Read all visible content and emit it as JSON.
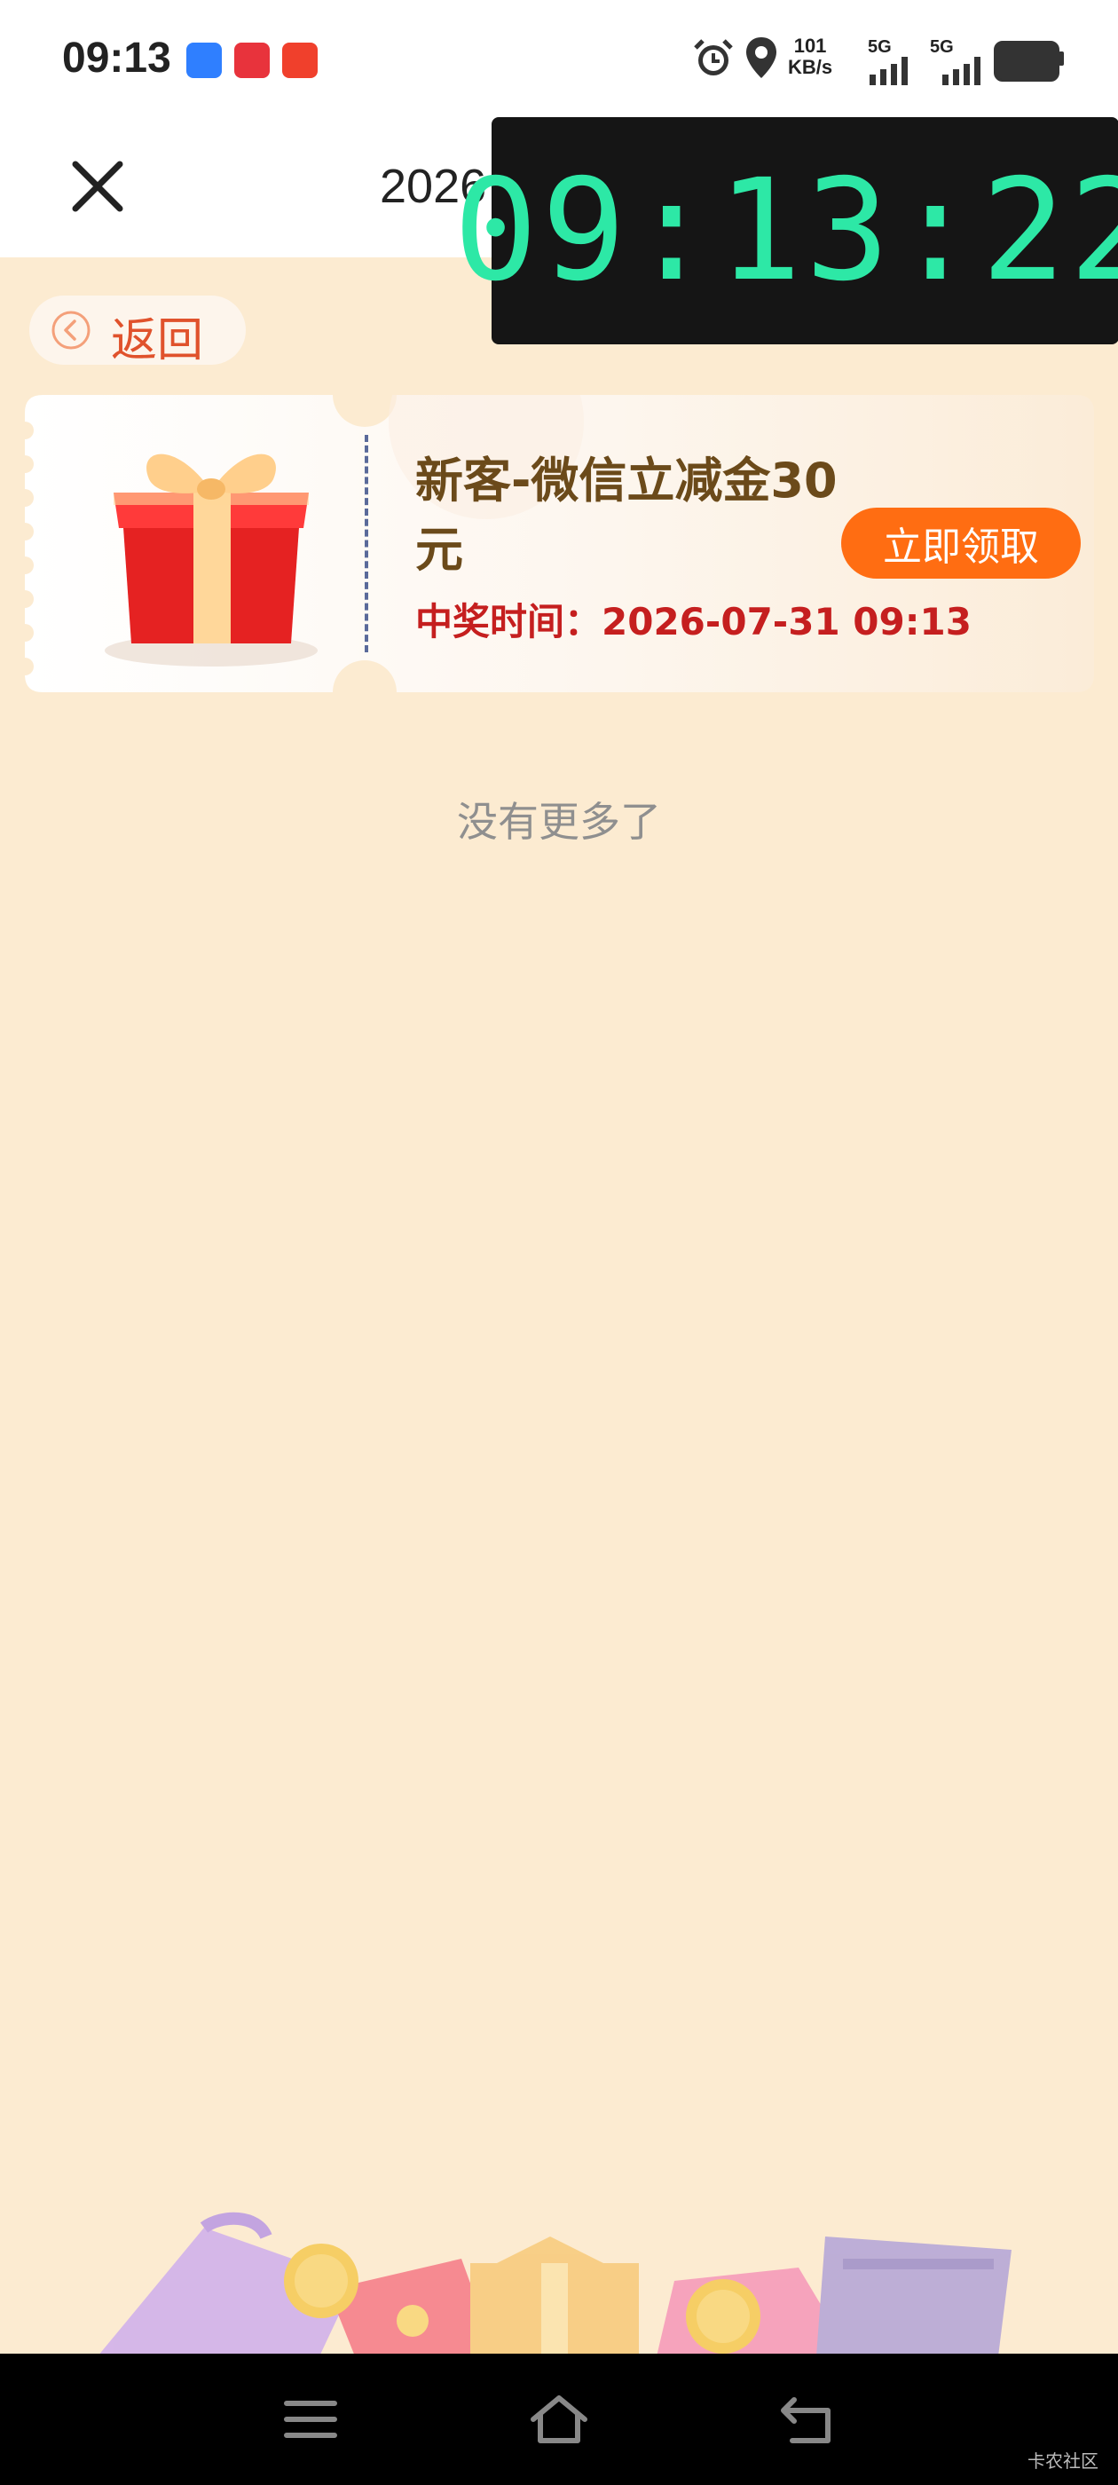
{
  "status_bar": {
    "time": "09:13",
    "net_speed_value": "101",
    "net_speed_unit": "KB/s",
    "signal1_label": "5G",
    "signal2_label": "5G",
    "app_icons": [
      "blue-app-icon",
      "xiaohongshu-icon",
      "red-app-icon"
    ]
  },
  "header": {
    "title": "2026"
  },
  "clock_overlay": {
    "time": "09:13:22"
  },
  "back_button": {
    "label": "返回"
  },
  "prize": {
    "title": "新客-微信立减金30元",
    "time_label": "中奖时间：",
    "time_value": "2026-07-31 09:13",
    "claim_label": "立即领取"
  },
  "list_end_text": "没有更多了",
  "watermark": "卡农社区",
  "colors": {
    "page_bg": "#fcebd1",
    "accent_orange": "#ff6d12",
    "title_brown": "#6b4a1a",
    "time_red": "#c51f1f",
    "clock_green": "#2de8a6"
  }
}
